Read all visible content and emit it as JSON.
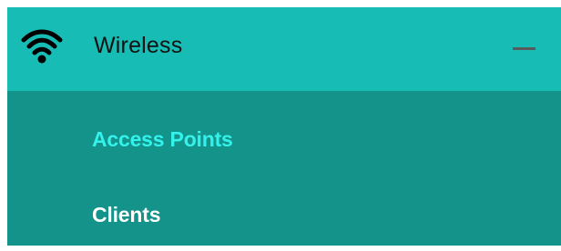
{
  "menu": {
    "header": {
      "label": "Wireless",
      "icon": "wifi-icon",
      "toggle_icon": "collapse-icon",
      "expanded": true
    },
    "items": [
      {
        "label": "Access Points",
        "active": true
      },
      {
        "label": "Clients",
        "active": false
      }
    ]
  },
  "colors": {
    "header_bg": "#17bdb4",
    "submenu_bg": "#139389",
    "active_text": "#33f2ec",
    "normal_text": "#ffffff",
    "header_text": "#111111"
  }
}
